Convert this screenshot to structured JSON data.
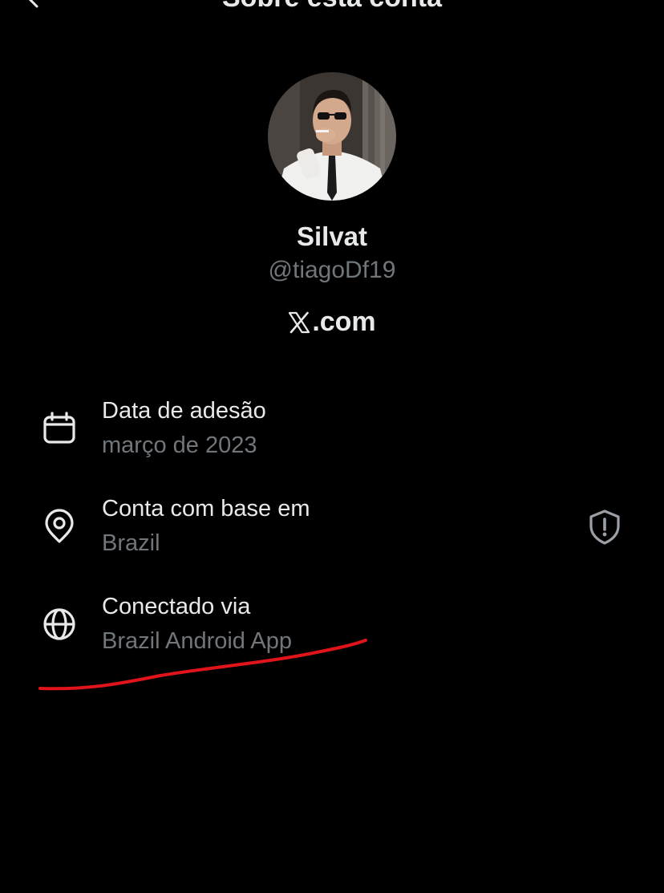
{
  "header": {
    "title": "Sobre esta conta"
  },
  "profile": {
    "display_name": "Silvat",
    "handle": "@tiagoDf19",
    "badge_text": ".com",
    "badge_logo": "x-logo-icon"
  },
  "details": [
    {
      "icon": "calendar-icon",
      "label": "Data de adesão",
      "value": "março de 2023"
    },
    {
      "icon": "location-pin-icon",
      "label": "Conta com base em",
      "value": "Brazil"
    },
    {
      "icon": "globe-icon",
      "label": "Conectado via",
      "value": "Brazil Android App"
    }
  ],
  "colors": {
    "background": "#000000",
    "primary_text": "#e7e9ea",
    "secondary_text": "#71767b",
    "annotation": "#e0141a"
  }
}
